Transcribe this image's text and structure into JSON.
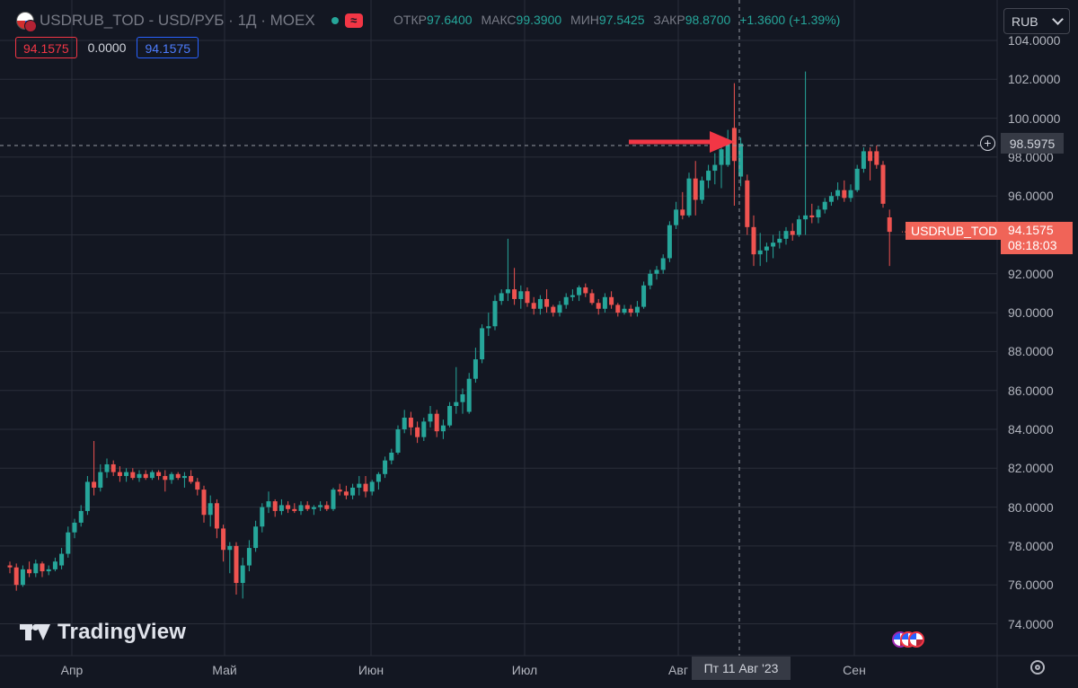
{
  "header": {
    "symbol_title": "USDRUB_TOD - USD/РУБ · 1Д · MOEX",
    "market_status_icon": "wave-icon",
    "ohlc": {
      "open_label": "ОТКР",
      "open": "97.6400",
      "high_label": "МАКС",
      "high": "99.3900",
      "low_label": "МИН",
      "low": "97.5425",
      "close_label": "ЗАКР",
      "close": "98.8700",
      "change": "+1.3600 (+1.39%)"
    },
    "bid": "94.1575",
    "spread": "0.0000",
    "ask": "94.1575",
    "currency": "RUB"
  },
  "watermark": "TradingView",
  "price_axis_labels": [
    "104.0000",
    "102.0000",
    "100.0000",
    "98.0000",
    "96.0000",
    "94.0000",
    "92.0000",
    "90.0000",
    "88.0000",
    "86.0000",
    "84.0000",
    "82.0000",
    "80.0000",
    "78.0000",
    "76.0000",
    "74.0000"
  ],
  "time_axis_labels": [
    "Апр",
    "Май",
    "Июн",
    "Июл",
    "Авг",
    "Сен"
  ],
  "crosshair": {
    "date": "Пт 11 Авг '23",
    "price": "98.5975"
  },
  "last_price": {
    "symbol": "USDRUB_TOD",
    "value": "94.1575",
    "countdown": "08:18:03"
  },
  "colors": {
    "background": "#131722",
    "up": "#26a69a",
    "down": "#ef5350",
    "grid": "#2a2e39",
    "arrow": "#f23645",
    "label": "#f06458"
  },
  "chart_data": {
    "type": "candlestick",
    "title": "USDRUB_TOD - USD/РУБ · 1Д · MOEX",
    "ylim": [
      73,
      104.5
    ],
    "grid": true,
    "annotation": "red arrow pointing to the 11 Aug 2023 candle",
    "candles": [
      {
        "o": 77.0,
        "h": 77.2,
        "l": 76.6,
        "c": 76.9
      },
      {
        "o": 76.9,
        "h": 77.1,
        "l": 75.7,
        "c": 76.0
      },
      {
        "o": 76.0,
        "h": 77.0,
        "l": 75.9,
        "c": 76.8
      },
      {
        "o": 76.8,
        "h": 77.2,
        "l": 76.4,
        "c": 76.6
      },
      {
        "o": 76.6,
        "h": 77.3,
        "l": 76.4,
        "c": 77.1
      },
      {
        "o": 77.1,
        "h": 77.2,
        "l": 76.4,
        "c": 76.7
      },
      {
        "o": 76.7,
        "h": 77.0,
        "l": 76.5,
        "c": 76.8
      },
      {
        "o": 76.8,
        "h": 77.4,
        "l": 76.7,
        "c": 77.2
      },
      {
        "o": 77.0,
        "h": 77.9,
        "l": 76.8,
        "c": 77.6
      },
      {
        "o": 77.6,
        "h": 79.0,
        "l": 77.4,
        "c": 78.7
      },
      {
        "o": 78.7,
        "h": 79.4,
        "l": 78.4,
        "c": 79.2
      },
      {
        "o": 79.2,
        "h": 80.1,
        "l": 79.0,
        "c": 79.8
      },
      {
        "o": 79.8,
        "h": 81.6,
        "l": 79.6,
        "c": 81.3
      },
      {
        "o": 81.3,
        "h": 83.4,
        "l": 80.6,
        "c": 81.0
      },
      {
        "o": 81.0,
        "h": 82.2,
        "l": 80.8,
        "c": 81.8
      },
      {
        "o": 81.8,
        "h": 82.5,
        "l": 81.5,
        "c": 82.2
      },
      {
        "o": 82.2,
        "h": 82.4,
        "l": 81.6,
        "c": 81.8
      },
      {
        "o": 81.8,
        "h": 82.1,
        "l": 81.3,
        "c": 81.6
      },
      {
        "o": 81.6,
        "h": 82.0,
        "l": 81.3,
        "c": 81.8
      },
      {
        "o": 81.8,
        "h": 82.0,
        "l": 81.4,
        "c": 81.5
      },
      {
        "o": 81.5,
        "h": 81.9,
        "l": 81.3,
        "c": 81.7
      },
      {
        "o": 81.7,
        "h": 81.9,
        "l": 81.4,
        "c": 81.5
      },
      {
        "o": 81.5,
        "h": 81.9,
        "l": 81.4,
        "c": 81.8
      },
      {
        "o": 81.8,
        "h": 81.9,
        "l": 81.4,
        "c": 81.6
      },
      {
        "o": 81.6,
        "h": 81.9,
        "l": 80.8,
        "c": 81.4
      },
      {
        "o": 81.4,
        "h": 81.8,
        "l": 81.2,
        "c": 81.7
      },
      {
        "o": 81.7,
        "h": 81.8,
        "l": 81.4,
        "c": 81.5
      },
      {
        "o": 81.5,
        "h": 81.8,
        "l": 81.0,
        "c": 81.6
      },
      {
        "o": 81.6,
        "h": 81.9,
        "l": 81.2,
        "c": 81.3
      },
      {
        "o": 81.3,
        "h": 81.5,
        "l": 80.6,
        "c": 80.9
      },
      {
        "o": 80.9,
        "h": 81.1,
        "l": 79.2,
        "c": 79.6
      },
      {
        "o": 79.6,
        "h": 80.6,
        "l": 79.0,
        "c": 80.2
      },
      {
        "o": 80.2,
        "h": 80.4,
        "l": 78.4,
        "c": 78.9
      },
      {
        "o": 78.9,
        "h": 79.1,
        "l": 77.2,
        "c": 77.8
      },
      {
        "o": 77.8,
        "h": 78.2,
        "l": 76.6,
        "c": 78.0
      },
      {
        "o": 78.0,
        "h": 78.2,
        "l": 75.5,
        "c": 76.1
      },
      {
        "o": 76.1,
        "h": 77.4,
        "l": 75.3,
        "c": 77.0
      },
      {
        "o": 77.0,
        "h": 78.3,
        "l": 76.7,
        "c": 77.9
      },
      {
        "o": 77.9,
        "h": 79.3,
        "l": 77.7,
        "c": 79.0
      },
      {
        "o": 79.0,
        "h": 80.2,
        "l": 78.7,
        "c": 80.0
      },
      {
        "o": 80.0,
        "h": 80.8,
        "l": 79.7,
        "c": 80.3
      },
      {
        "o": 80.3,
        "h": 80.4,
        "l": 79.5,
        "c": 79.8
      },
      {
        "o": 79.8,
        "h": 80.4,
        "l": 79.6,
        "c": 80.1
      },
      {
        "o": 80.1,
        "h": 80.3,
        "l": 79.7,
        "c": 79.9
      },
      {
        "o": 79.9,
        "h": 80.2,
        "l": 79.7,
        "c": 79.8
      },
      {
        "o": 79.8,
        "h": 80.3,
        "l": 79.6,
        "c": 80.1
      },
      {
        "o": 80.1,
        "h": 80.3,
        "l": 79.8,
        "c": 79.9
      },
      {
        "o": 79.9,
        "h": 80.1,
        "l": 79.6,
        "c": 80.0
      },
      {
        "o": 80.0,
        "h": 80.3,
        "l": 79.8,
        "c": 80.1
      },
      {
        "o": 80.1,
        "h": 80.3,
        "l": 79.8,
        "c": 79.9
      },
      {
        "o": 79.9,
        "h": 81.0,
        "l": 79.8,
        "c": 80.9
      },
      {
        "o": 80.9,
        "h": 81.2,
        "l": 80.6,
        "c": 80.8
      },
      {
        "o": 80.8,
        "h": 81.1,
        "l": 80.4,
        "c": 80.6
      },
      {
        "o": 80.6,
        "h": 81.2,
        "l": 80.4,
        "c": 81.0
      },
      {
        "o": 81.0,
        "h": 81.6,
        "l": 80.6,
        "c": 81.2
      },
      {
        "o": 81.2,
        "h": 81.6,
        "l": 80.5,
        "c": 80.8
      },
      {
        "o": 80.8,
        "h": 81.4,
        "l": 80.6,
        "c": 81.3
      },
      {
        "o": 81.3,
        "h": 81.8,
        "l": 80.9,
        "c": 81.7
      },
      {
        "o": 81.7,
        "h": 82.6,
        "l": 81.5,
        "c": 82.4
      },
      {
        "o": 82.4,
        "h": 83.0,
        "l": 82.2,
        "c": 82.8
      },
      {
        "o": 82.8,
        "h": 84.2,
        "l": 82.7,
        "c": 84.0
      },
      {
        "o": 84.0,
        "h": 85.0,
        "l": 83.8,
        "c": 84.6
      },
      {
        "o": 84.6,
        "h": 84.9,
        "l": 83.7,
        "c": 84.1
      },
      {
        "o": 84.1,
        "h": 84.4,
        "l": 83.3,
        "c": 83.6
      },
      {
        "o": 83.6,
        "h": 84.6,
        "l": 83.4,
        "c": 84.4
      },
      {
        "o": 84.4,
        "h": 85.2,
        "l": 84.1,
        "c": 84.8
      },
      {
        "o": 84.8,
        "h": 85.0,
        "l": 83.6,
        "c": 83.9
      },
      {
        "o": 83.9,
        "h": 84.5,
        "l": 83.5,
        "c": 84.2
      },
      {
        "o": 84.2,
        "h": 85.4,
        "l": 84.1,
        "c": 85.2
      },
      {
        "o": 85.2,
        "h": 87.2,
        "l": 84.8,
        "c": 85.4
      },
      {
        "o": 85.4,
        "h": 86.1,
        "l": 84.8,
        "c": 85.8
      },
      {
        "o": 84.9,
        "h": 86.9,
        "l": 84.8,
        "c": 86.6
      },
      {
        "o": 86.6,
        "h": 88.2,
        "l": 86.4,
        "c": 87.6
      },
      {
        "o": 87.6,
        "h": 89.4,
        "l": 87.4,
        "c": 89.2
      },
      {
        "o": 89.2,
        "h": 90.0,
        "l": 88.8,
        "c": 89.3
      },
      {
        "o": 89.3,
        "h": 90.9,
        "l": 89.1,
        "c": 90.6
      },
      {
        "o": 90.6,
        "h": 91.2,
        "l": 90.4,
        "c": 91.0
      },
      {
        "o": 91.0,
        "h": 93.8,
        "l": 90.6,
        "c": 91.2
      },
      {
        "o": 91.2,
        "h": 92.3,
        "l": 90.4,
        "c": 90.7
      },
      {
        "o": 90.7,
        "h": 91.4,
        "l": 90.2,
        "c": 91.1
      },
      {
        "o": 91.1,
        "h": 91.3,
        "l": 90.3,
        "c": 90.5
      },
      {
        "o": 90.5,
        "h": 90.8,
        "l": 89.9,
        "c": 90.2
      },
      {
        "o": 90.2,
        "h": 90.9,
        "l": 89.9,
        "c": 90.7
      },
      {
        "o": 90.7,
        "h": 91.2,
        "l": 90.0,
        "c": 90.3
      },
      {
        "o": 90.3,
        "h": 90.4,
        "l": 89.8,
        "c": 90.0
      },
      {
        "o": 90.0,
        "h": 90.6,
        "l": 89.8,
        "c": 90.4
      },
      {
        "o": 90.4,
        "h": 91.0,
        "l": 90.2,
        "c": 90.8
      },
      {
        "o": 90.8,
        "h": 91.2,
        "l": 90.6,
        "c": 90.9
      },
      {
        "o": 90.9,
        "h": 91.4,
        "l": 90.6,
        "c": 91.3
      },
      {
        "o": 91.3,
        "h": 91.5,
        "l": 90.8,
        "c": 91.0
      },
      {
        "o": 91.0,
        "h": 91.2,
        "l": 90.4,
        "c": 90.5
      },
      {
        "o": 90.5,
        "h": 90.7,
        "l": 89.9,
        "c": 90.2
      },
      {
        "o": 90.2,
        "h": 91.0,
        "l": 90.0,
        "c": 90.8
      },
      {
        "o": 90.8,
        "h": 91.1,
        "l": 90.2,
        "c": 90.4
      },
      {
        "o": 90.4,
        "h": 90.5,
        "l": 89.8,
        "c": 90.0
      },
      {
        "o": 90.0,
        "h": 90.4,
        "l": 89.9,
        "c": 90.2
      },
      {
        "o": 90.2,
        "h": 90.4,
        "l": 89.8,
        "c": 90.0
      },
      {
        "o": 90.0,
        "h": 90.6,
        "l": 89.8,
        "c": 90.3
      },
      {
        "o": 90.3,
        "h": 91.6,
        "l": 90.2,
        "c": 91.4
      },
      {
        "o": 91.4,
        "h": 92.2,
        "l": 91.2,
        "c": 92.0
      },
      {
        "o": 92.0,
        "h": 92.4,
        "l": 91.7,
        "c": 92.2
      },
      {
        "o": 92.2,
        "h": 93.0,
        "l": 92.0,
        "c": 92.8
      },
      {
        "o": 92.8,
        "h": 94.7,
        "l": 92.6,
        "c": 94.5
      },
      {
        "o": 94.5,
        "h": 95.7,
        "l": 94.3,
        "c": 95.3
      },
      {
        "o": 95.3,
        "h": 96.2,
        "l": 94.8,
        "c": 95.0
      },
      {
        "o": 95.0,
        "h": 97.2,
        "l": 94.9,
        "c": 96.9
      },
      {
        "o": 96.9,
        "h": 97.8,
        "l": 95.0,
        "c": 95.8
      },
      {
        "o": 95.8,
        "h": 97.0,
        "l": 95.6,
        "c": 96.8
      },
      {
        "o": 96.8,
        "h": 97.6,
        "l": 96.4,
        "c": 97.3
      },
      {
        "o": 97.3,
        "h": 98.2,
        "l": 96.6,
        "c": 97.6
      },
      {
        "o": 97.6,
        "h": 98.9,
        "l": 96.4,
        "c": 98.4
      },
      {
        "o": 97.6,
        "h": 99.4,
        "l": 97.5,
        "c": 98.9
      },
      {
        "o": 99.5,
        "h": 101.8,
        "l": 95.5,
        "c": 97.8
      },
      {
        "o": 97.0,
        "h": 99.0,
        "l": 96.5,
        "c": 98.7
      },
      {
        "o": 96.8,
        "h": 97.1,
        "l": 94.0,
        "c": 94.4
      },
      {
        "o": 94.4,
        "h": 95.0,
        "l": 92.4,
        "c": 93.0
      },
      {
        "o": 93.0,
        "h": 94.1,
        "l": 92.4,
        "c": 93.2
      },
      {
        "o": 93.2,
        "h": 93.6,
        "l": 92.6,
        "c": 93.4
      },
      {
        "o": 93.4,
        "h": 94.0,
        "l": 92.8,
        "c": 93.6
      },
      {
        "o": 93.6,
        "h": 94.2,
        "l": 93.3,
        "c": 93.8
      },
      {
        "o": 93.8,
        "h": 94.4,
        "l": 93.5,
        "c": 94.2
      },
      {
        "o": 94.2,
        "h": 94.6,
        "l": 93.7,
        "c": 94.0
      },
      {
        "o": 94.0,
        "h": 95.0,
        "l": 93.9,
        "c": 94.8
      },
      {
        "o": 94.8,
        "h": 102.4,
        "l": 94.0,
        "c": 95.0
      },
      {
        "o": 95.0,
        "h": 95.6,
        "l": 94.6,
        "c": 94.9
      },
      {
        "o": 94.9,
        "h": 95.5,
        "l": 94.6,
        "c": 95.3
      },
      {
        "o": 95.3,
        "h": 95.9,
        "l": 95.1,
        "c": 95.7
      },
      {
        "o": 95.7,
        "h": 96.2,
        "l": 95.5,
        "c": 96.0
      },
      {
        "o": 96.0,
        "h": 96.7,
        "l": 95.8,
        "c": 96.3
      },
      {
        "o": 96.3,
        "h": 96.8,
        "l": 95.7,
        "c": 95.9
      },
      {
        "o": 95.9,
        "h": 96.6,
        "l": 95.7,
        "c": 96.3
      },
      {
        "o": 96.3,
        "h": 97.6,
        "l": 96.2,
        "c": 97.4
      },
      {
        "o": 97.4,
        "h": 98.5,
        "l": 97.2,
        "c": 98.3
      },
      {
        "o": 98.3,
        "h": 98.5,
        "l": 96.8,
        "c": 97.8
      },
      {
        "o": 98.3,
        "h": 98.6,
        "l": 97.4,
        "c": 97.6
      },
      {
        "o": 97.6,
        "h": 97.8,
        "l": 95.4,
        "c": 95.6
      },
      {
        "o": 94.9,
        "h": 95.3,
        "l": 92.4,
        "c": 94.1575
      }
    ]
  }
}
